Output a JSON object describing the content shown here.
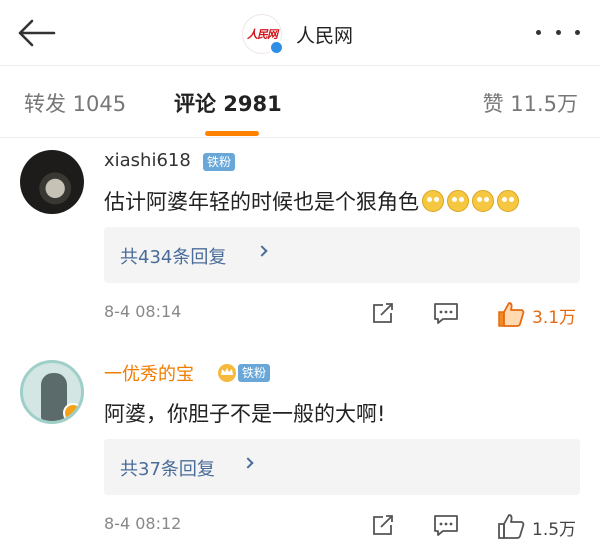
{
  "header": {
    "account_name": "人民网",
    "logo_text": "人民网",
    "icons": {
      "back": "back-arrow-icon",
      "more": "more-dots-icon",
      "verified": "verified-badge-icon"
    }
  },
  "tabs": {
    "repost": "转发 1045",
    "comment": "评论 2981",
    "like": "赞 11.5万",
    "active": "comment",
    "accent_color": "#ff8200"
  },
  "comments": [
    {
      "username": "xiashi618",
      "fan_badge": "铁粉",
      "text": "估计阿婆年轻的时候也是个狠角色",
      "emoji_count": 4,
      "replies": "共434条回复",
      "time": "8-4 08:14",
      "likes": "3.1万",
      "liked": true
    },
    {
      "username": "一优秀的宝",
      "fan_badge": "铁粉",
      "text": "阿婆，你胆子不是一般的大啊!",
      "emoji_count": 0,
      "replies": "共37条回复",
      "time": "8-4 08:12",
      "likes": "1.5万",
      "liked": false
    }
  ]
}
